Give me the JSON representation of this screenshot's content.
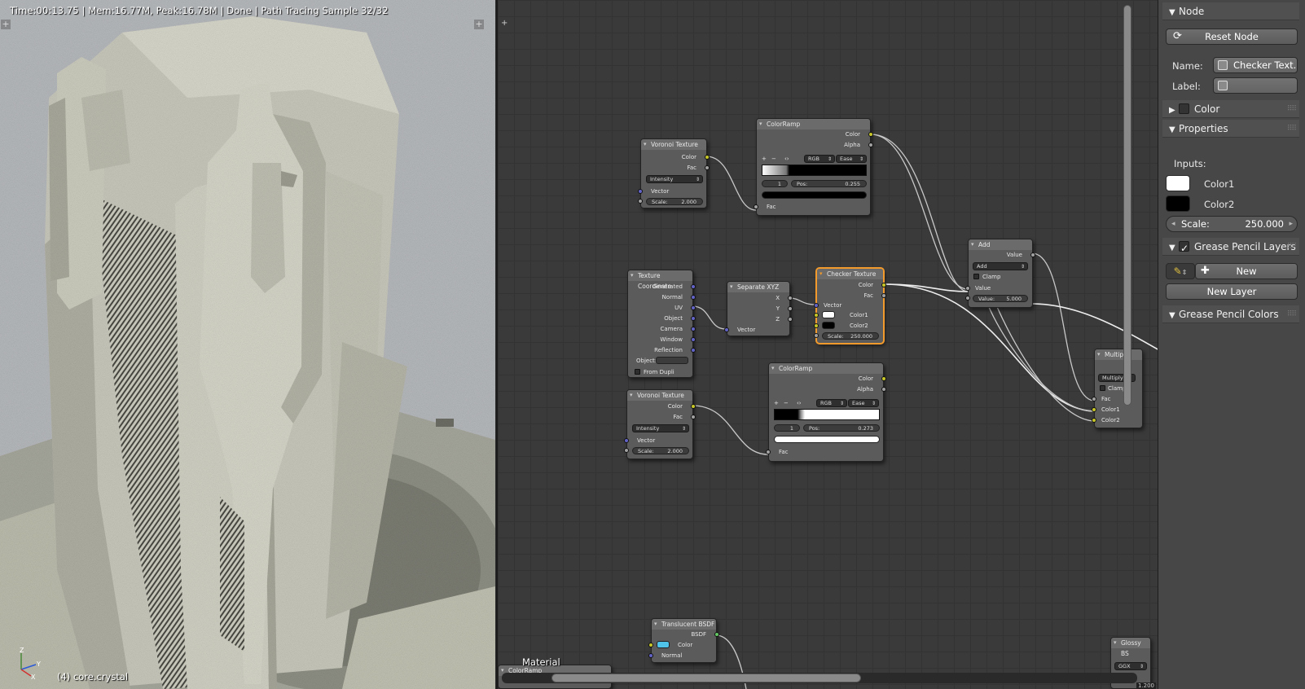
{
  "viewport": {
    "status_text": "Time:00:13.75 | Mem:16.77M, Peak:16.78M | Done | Path Tracing Sample 32/32",
    "object_name": "(4) core.crystal",
    "axis_x": "X",
    "axis_y": "Y",
    "axis_z": "Z"
  },
  "node_editor": {
    "material_label": "Material",
    "nodes": {
      "voronoi1": {
        "title": "Voronoi Texture",
        "out_color": "Color",
        "out_fac": "Fac",
        "coloring": "Intensity",
        "in_vector": "Vector",
        "scale_label": "Scale:",
        "scale_value": "2.000"
      },
      "colorramp1": {
        "title": "ColorRamp",
        "out_color": "Color",
        "out_alpha": "Alpha",
        "mode": "RGB",
        "interp": "Ease",
        "stop_index": "1",
        "pos_label": "Pos:",
        "pos_value": "0.255",
        "in_fac": "Fac",
        "plus": "+",
        "minus": "−",
        "flip": "‹›"
      },
      "texcoord": {
        "title": "Texture Coordinate",
        "outputs": [
          "Generated",
          "Normal",
          "UV",
          "Object",
          "Camera",
          "Window",
          "Reflection"
        ],
        "object_label": "Object:",
        "from_dupli": "From Dupli"
      },
      "separate": {
        "title": "Separate XYZ",
        "out_x": "X",
        "out_y": "Y",
        "out_z": "Z",
        "in_vector": "Vector"
      },
      "checker": {
        "title": "Checker Texture",
        "out_color": "Color",
        "out_fac": "Fac",
        "in_vector": "Vector",
        "in_color1": "Color1",
        "in_color2": "Color2",
        "scale_label": "Scale:",
        "scale_value": "250.000"
      },
      "colorramp2": {
        "title": "ColorRamp",
        "out_color": "Color",
        "out_alpha": "Alpha",
        "mode": "RGB",
        "interp": "Ease",
        "stop_index": "1",
        "pos_label": "Pos:",
        "pos_value": "0.273",
        "in_fac": "Fac",
        "plus": "+",
        "minus": "−",
        "flip": "‹›"
      },
      "voronoi2": {
        "title": "Voronoi Texture",
        "out_color": "Color",
        "out_fac": "Fac",
        "coloring": "Intensity",
        "in_vector": "Vector",
        "scale_label": "Scale:",
        "scale_value": "2.000"
      },
      "add": {
        "title": "Add",
        "out_value": "Value",
        "operation": "Add",
        "clamp": "Clamp",
        "in_value": "Value",
        "value_label": "Value:",
        "value_value": "5.000"
      },
      "multiply": {
        "title": "Multiply",
        "operation": "Multiply",
        "clamp": "Clamp",
        "in_fac": "Fac",
        "in_color1": "Color1",
        "in_color2": "Color2"
      },
      "translucent": {
        "title": "Translucent BSDF",
        "out_bsdf": "BSDF",
        "in_color": "Color",
        "in_normal": "Normal"
      },
      "glossy": {
        "title": "Glossy BS",
        "distribution": "GGX"
      },
      "colorramp3": {
        "title": "ColorRamp"
      }
    },
    "corner_value": "1.200"
  },
  "properties": {
    "node_section": "Node",
    "reset_node": "Reset Node",
    "name_label": "Name:",
    "name_value": "Checker Text...",
    "label_label": "Label:",
    "label_value": "",
    "color_section": "Color",
    "properties_section": "Properties",
    "inputs_label": "Inputs:",
    "color1_label": "Color1",
    "color2_label": "Color2",
    "scale_label": "Scale:",
    "scale_value": "250.000",
    "grease_layers_section": "Grease Pencil Layers",
    "new_button": "New",
    "new_layer_button": "New Layer",
    "grease_colors_section": "Grease Pencil Colors",
    "colors": {
      "color1": "#ffffff",
      "color2": "#000000"
    }
  }
}
